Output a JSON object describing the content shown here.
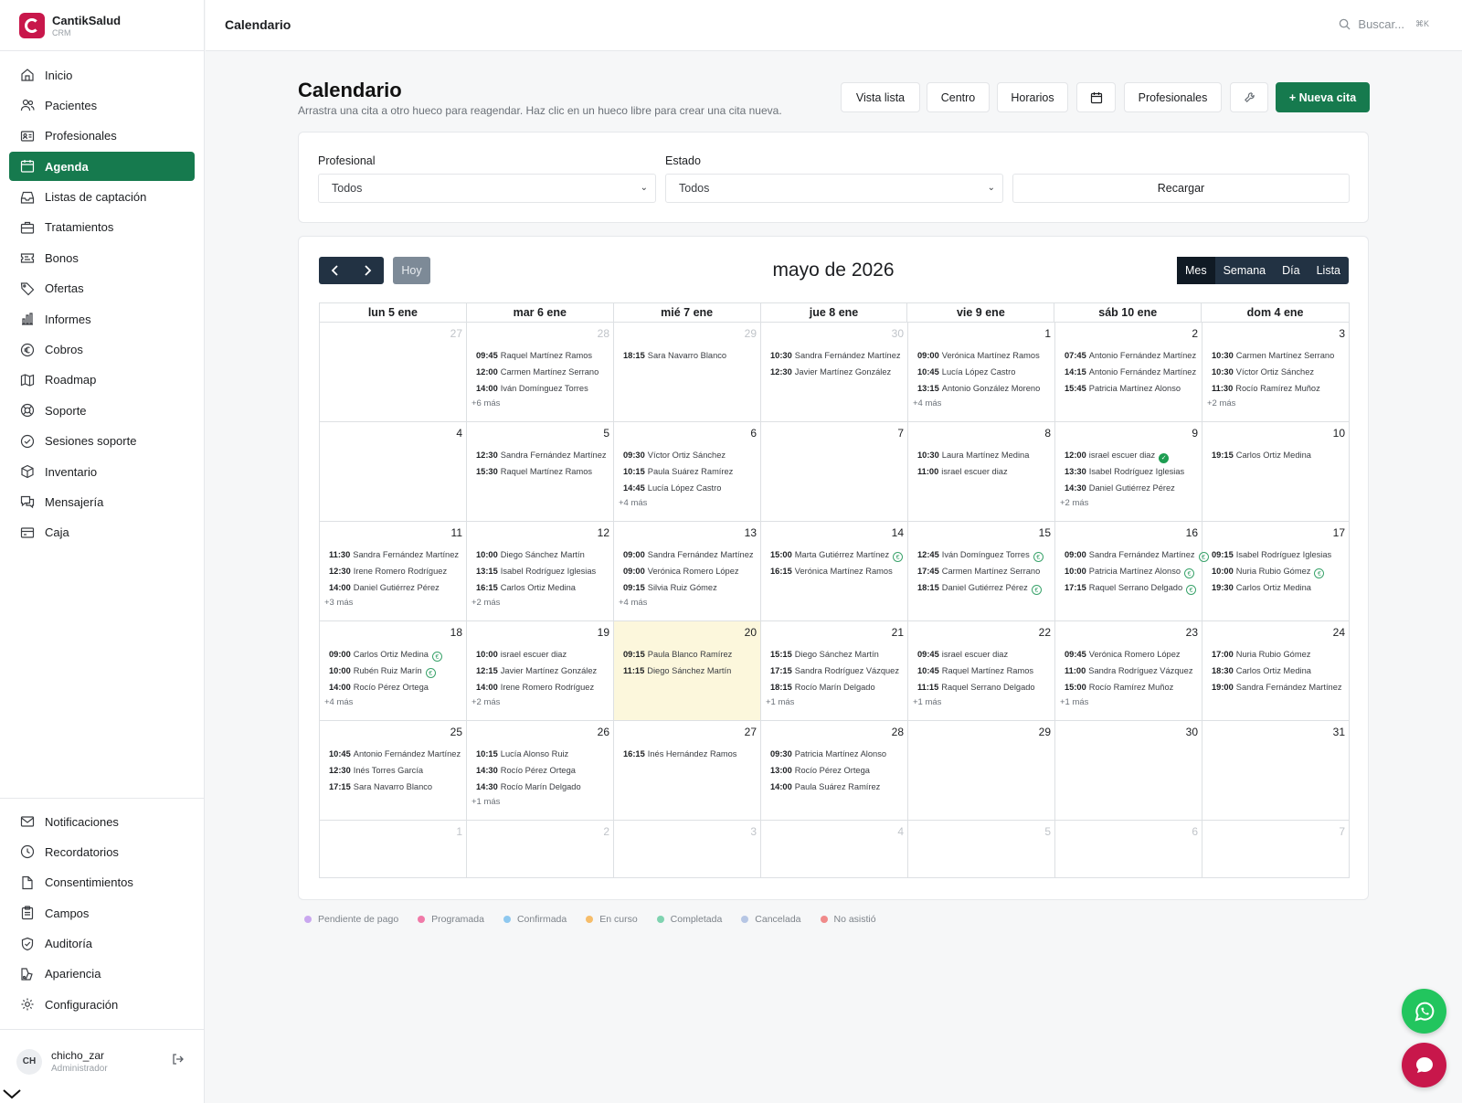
{
  "brand": {
    "name": "CantikSalud",
    "sub": "CRM"
  },
  "nav_top": [
    {
      "label": "Inicio",
      "icon": "home-icon"
    },
    {
      "label": "Pacientes",
      "icon": "users-icon"
    },
    {
      "label": "Profesionales",
      "icon": "id-card-icon"
    },
    {
      "label": "Agenda",
      "icon": "calendar-icon",
      "active": true
    },
    {
      "label": "Listas de captación",
      "icon": "inbox-icon"
    },
    {
      "label": "Tratamientos",
      "icon": "briefcase-icon"
    },
    {
      "label": "Bonos",
      "icon": "ticket-icon"
    },
    {
      "label": "Ofertas",
      "icon": "tag-icon"
    },
    {
      "label": "Informes",
      "icon": "bar-chart-icon"
    },
    {
      "label": "Cobros",
      "icon": "euro-icon"
    },
    {
      "label": "Roadmap",
      "icon": "map-icon"
    },
    {
      "label": "Soporte",
      "icon": "lifebuoy-icon"
    },
    {
      "label": "Sesiones soporte",
      "icon": "check-circle-icon"
    },
    {
      "label": "Inventario",
      "icon": "box-icon"
    },
    {
      "label": "Mensajería",
      "icon": "chat-icon"
    },
    {
      "label": "Caja",
      "icon": "credit-card-icon"
    }
  ],
  "nav_bottom": [
    {
      "label": "Notificaciones",
      "icon": "mail-icon"
    },
    {
      "label": "Recordatorios",
      "icon": "clock-icon"
    },
    {
      "label": "Consentimientos",
      "icon": "file-icon"
    },
    {
      "label": "Campos",
      "icon": "clipboard-icon"
    },
    {
      "label": "Auditoría",
      "icon": "shield-check-icon"
    },
    {
      "label": "Apariencia",
      "icon": "palette-icon"
    },
    {
      "label": "Configuración",
      "icon": "gear-icon"
    }
  ],
  "user": {
    "initials": "CH",
    "name": "chicho_zar",
    "role": "Administrador"
  },
  "topbar": {
    "title": "Calendario",
    "search_placeholder": "Buscar...",
    "shortcut": "⌘K"
  },
  "header": {
    "title": "Calendario",
    "subtitle": "Arrastra una cita a otro hueco para reagendar. Haz clic en un hueco libre para crear una cita nueva."
  },
  "toolbar": {
    "vista_lista": "Vista lista",
    "centro": "Centro",
    "horarios": "Horarios",
    "profesionales": "Profesionales",
    "nueva_cita": "+ Nueva cita"
  },
  "filters": {
    "profesional_label": "Profesional",
    "profesional_value": "Todos",
    "estado_label": "Estado",
    "estado_value": "Todos",
    "reload": "Recargar"
  },
  "calendar": {
    "today_label": "Hoy",
    "title": "mayo de 2026",
    "views": [
      "Mes",
      "Semana",
      "Día",
      "Lista"
    ],
    "active_view": "Mes",
    "day_headers": [
      "lun 5 ene",
      "mar 6 ene",
      "mié 7 ene",
      "jue 8 ene",
      "vie 9 ene",
      "sáb 10 ene",
      "dom 4 ene"
    ],
    "weeks": [
      [
        {
          "day": "27",
          "other": true,
          "events": []
        },
        {
          "day": "28",
          "other": true,
          "events": [
            [
              "09:45",
              "Raquel Martínez Ramos"
            ],
            [
              "12:00",
              "Carmen Martínez Serrano"
            ],
            [
              "14:00",
              "Iván Domínguez Torres"
            ]
          ],
          "more": "+6 más"
        },
        {
          "day": "29",
          "other": true,
          "events": [
            [
              "18:15",
              "Sara Navarro Blanco"
            ]
          ]
        },
        {
          "day": "30",
          "other": true,
          "events": [
            [
              "10:30",
              "Sandra Fernández Martínez"
            ],
            [
              "12:30",
              "Javier Martínez González"
            ]
          ]
        },
        {
          "day": "1",
          "events": [
            [
              "09:00",
              "Verónica Martínez Ramos"
            ],
            [
              "10:45",
              "Lucía López Castro"
            ],
            [
              "13:15",
              "Antonio González Moreno"
            ]
          ],
          "more": "+4 más"
        },
        {
          "day": "2",
          "events": [
            [
              "07:45",
              "Antonio Fernández Martínez"
            ],
            [
              "14:15",
              "Antonio Fernández Martínez"
            ],
            [
              "15:45",
              "Patricia Martínez Alonso"
            ]
          ]
        },
        {
          "day": "3",
          "events": [
            [
              "10:30",
              "Carmen Martínez Serrano"
            ],
            [
              "10:30",
              "Víctor Ortiz Sánchez"
            ],
            [
              "11:30",
              "Rocío Ramírez Muñoz"
            ]
          ],
          "more": "+2 más"
        }
      ],
      [
        {
          "day": "4",
          "events": []
        },
        {
          "day": "5",
          "events": [
            [
              "12:30",
              "Sandra Fernández Martínez"
            ],
            [
              "15:30",
              "Raquel Martínez Ramos"
            ]
          ]
        },
        {
          "day": "6",
          "events": [
            [
              "09:30",
              "Víctor Ortiz Sánchez"
            ],
            [
              "10:15",
              "Paula Suárez Ramírez"
            ],
            [
              "14:45",
              "Lucía López Castro"
            ]
          ],
          "more": "+4 más"
        },
        {
          "day": "7",
          "events": []
        },
        {
          "day": "8",
          "events": [
            [
              "10:30",
              "Laura Martínez Medina"
            ],
            [
              "11:00",
              "israel escuer diaz"
            ]
          ]
        },
        {
          "day": "9",
          "events": [
            [
              "12:00",
              "israel escuer diaz",
              "check"
            ],
            [
              "13:30",
              "Isabel Rodríguez Iglesias"
            ],
            [
              "14:30",
              "Daniel Gutiérrez Pérez"
            ]
          ],
          "more": "+2 más"
        },
        {
          "day": "10",
          "events": [
            [
              "19:15",
              "Carlos Ortiz Medina"
            ]
          ]
        }
      ],
      [
        {
          "day": "11",
          "events": [
            [
              "11:30",
              "Sandra Fernández Martínez"
            ],
            [
              "12:30",
              "Irene Romero Rodríguez"
            ],
            [
              "14:00",
              "Daniel Gutiérrez Pérez"
            ]
          ],
          "more": "+3 más"
        },
        {
          "day": "12",
          "events": [
            [
              "10:00",
              "Diego Sánchez Martín"
            ],
            [
              "13:15",
              "Isabel Rodríguez Iglesias"
            ],
            [
              "16:15",
              "Carlos Ortiz Medina"
            ]
          ],
          "more": "+2 más"
        },
        {
          "day": "13",
          "events": [
            [
              "09:00",
              "Sandra Fernández Martínez"
            ],
            [
              "09:00",
              "Verónica Romero López"
            ],
            [
              "09:15",
              "Silvia Ruiz Gómez"
            ]
          ],
          "more": "+4 más"
        },
        {
          "day": "14",
          "events": [
            [
              "15:00",
              "Marta Gutiérrez Martínez",
              "euro"
            ],
            [
              "16:15",
              "Verónica Martínez Ramos"
            ]
          ]
        },
        {
          "day": "15",
          "events": [
            [
              "12:45",
              "Iván Domínguez Torres",
              "euro"
            ],
            [
              "17:45",
              "Carmen Martínez Serrano"
            ],
            [
              "18:15",
              "Daniel Gutiérrez Pérez",
              "euro"
            ]
          ]
        },
        {
          "day": "16",
          "events": [
            [
              "09:00",
              "Sandra Fernández Martínez",
              "euro"
            ],
            [
              "10:00",
              "Patricia Martínez Alonso",
              "euro"
            ],
            [
              "17:15",
              "Raquel Serrano Delgado",
              "euro"
            ]
          ]
        },
        {
          "day": "17",
          "events": [
            [
              "09:15",
              "Isabel Rodríguez Iglesias"
            ],
            [
              "10:00",
              "Nuria Rubio Gómez",
              "euro"
            ],
            [
              "19:30",
              "Carlos Ortiz Medina"
            ]
          ]
        }
      ],
      [
        {
          "day": "18",
          "events": [
            [
              "09:00",
              "Carlos Ortiz Medina",
              "euro"
            ],
            [
              "10:00",
              "Rubén Ruiz Marín",
              "euro"
            ],
            [
              "14:00",
              "Rocío Pérez Ortega"
            ]
          ],
          "more": "+4 más"
        },
        {
          "day": "19",
          "events": [
            [
              "10:00",
              "israel escuer diaz"
            ],
            [
              "12:15",
              "Javier Martínez González"
            ],
            [
              "14:00",
              "Irene Romero Rodríguez"
            ]
          ],
          "more": "+2 más"
        },
        {
          "day": "20",
          "today": true,
          "events": [
            [
              "09:15",
              "Paula Blanco Ramírez"
            ],
            [
              "11:15",
              "Diego Sánchez Martín"
            ]
          ]
        },
        {
          "day": "21",
          "events": [
            [
              "15:15",
              "Diego Sánchez Martín"
            ],
            [
              "17:15",
              "Sandra Rodríguez Vázquez"
            ],
            [
              "18:15",
              "Rocío Marín Delgado"
            ]
          ],
          "more": "+1 más"
        },
        {
          "day": "22",
          "events": [
            [
              "09:45",
              "israel escuer diaz"
            ],
            [
              "10:45",
              "Raquel Martínez Ramos"
            ],
            [
              "11:15",
              "Raquel Serrano Delgado"
            ]
          ],
          "more": "+1 más"
        },
        {
          "day": "23",
          "events": [
            [
              "09:45",
              "Verónica Romero López"
            ],
            [
              "11:00",
              "Sandra Rodríguez Vázquez"
            ],
            [
              "15:00",
              "Rocío Ramírez Muñoz"
            ]
          ],
          "more": "+1 más"
        },
        {
          "day": "24",
          "events": [
            [
              "17:00",
              "Nuria Rubio Gómez"
            ],
            [
              "18:30",
              "Carlos Ortiz Medina"
            ],
            [
              "19:00",
              "Sandra Fernández Martínez"
            ]
          ]
        }
      ],
      [
        {
          "day": "25",
          "events": [
            [
              "10:45",
              "Antonio Fernández Martínez"
            ],
            [
              "12:30",
              "Inés Torres García"
            ],
            [
              "17:15",
              "Sara Navarro Blanco"
            ]
          ]
        },
        {
          "day": "26",
          "events": [
            [
              "10:15",
              "Lucía Alonso Ruiz"
            ],
            [
              "14:30",
              "Rocío Pérez Ortega"
            ],
            [
              "14:30",
              "Rocío Marín Delgado"
            ]
          ],
          "more": "+1 más"
        },
        {
          "day": "27",
          "events": [
            [
              "16:15",
              "Inés Hernández Ramos"
            ]
          ]
        },
        {
          "day": "28",
          "events": [
            [
              "09:30",
              "Patricia Martínez Alonso"
            ],
            [
              "13:00",
              "Rocío Pérez Ortega"
            ],
            [
              "14:00",
              "Paula Suárez Ramírez"
            ]
          ]
        },
        {
          "day": "29",
          "events": []
        },
        {
          "day": "30",
          "events": []
        },
        {
          "day": "31",
          "events": []
        }
      ],
      [
        {
          "day": "1",
          "other": true,
          "events": []
        },
        {
          "day": "2",
          "other": true,
          "events": []
        },
        {
          "day": "3",
          "other": true,
          "events": []
        },
        {
          "day": "4",
          "other": true,
          "events": []
        },
        {
          "day": "5",
          "other": true,
          "events": []
        },
        {
          "day": "6",
          "other": true,
          "events": []
        },
        {
          "day": "7",
          "other": true,
          "events": []
        }
      ]
    ]
  },
  "legend": [
    {
      "label": "Pendiente de pago",
      "color": "#c9a7ef"
    },
    {
      "label": "Programada",
      "color": "#f07aa8"
    },
    {
      "label": "Confirmada",
      "color": "#8ec8ef"
    },
    {
      "label": "En curso",
      "color": "#f6bd6a"
    },
    {
      "label": "Completada",
      "color": "#7fd3b0"
    },
    {
      "label": "Cancelada",
      "color": "#b6c6e4"
    },
    {
      "label": "No asistió",
      "color": "#f08a8a"
    }
  ],
  "colors": {
    "brand": "#c8174b",
    "primary": "#167a4e",
    "calendar_dark": "#223243",
    "today_bg": "#fcf7dc"
  }
}
